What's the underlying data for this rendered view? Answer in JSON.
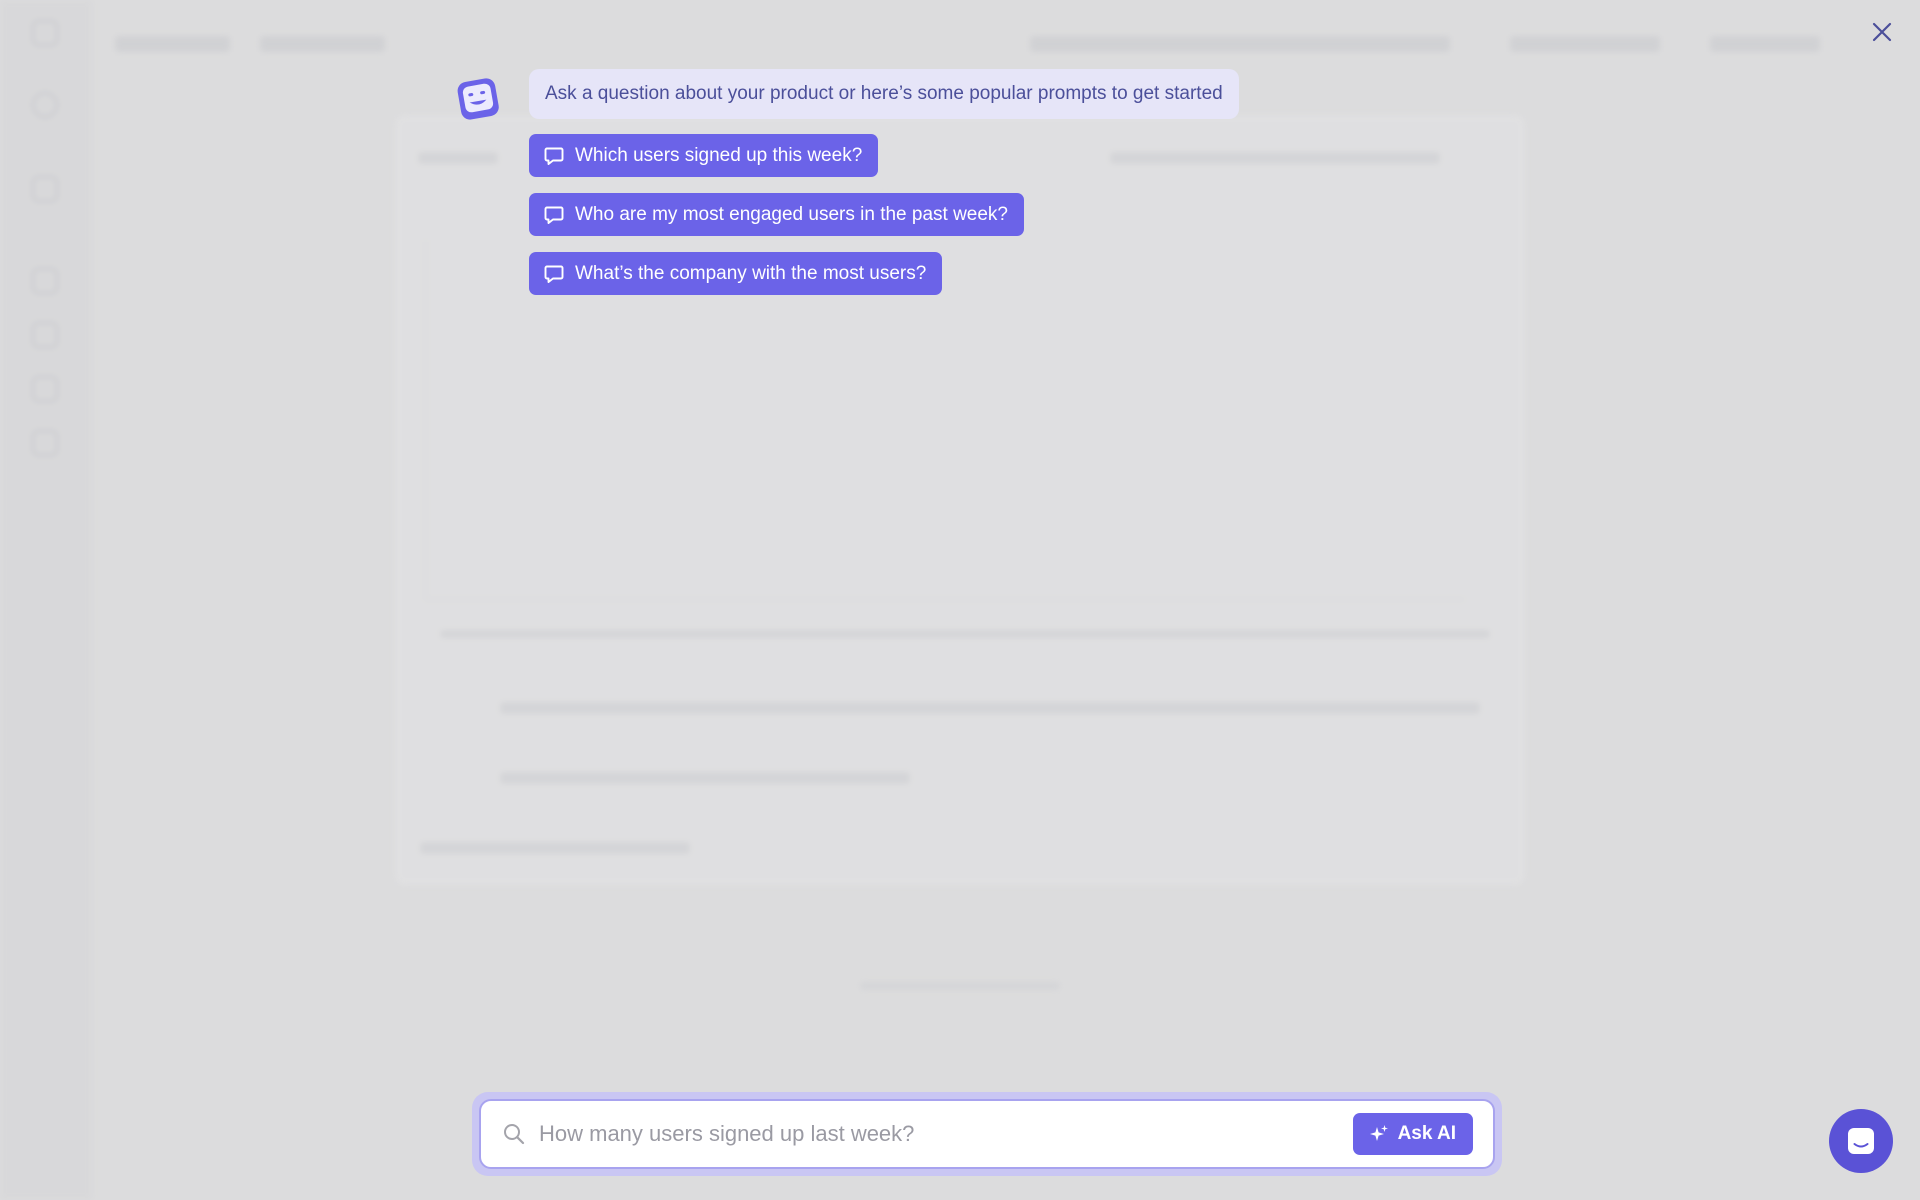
{
  "overlay": {
    "intro_text": "Ask a question about your product or here’s some popular prompts to get started",
    "prompts": [
      "Which users signed up this week?",
      "Who are my most engaged users in the past week?",
      "What’s the company with the most users?"
    ]
  },
  "search": {
    "placeholder": "How many users signed up last week?",
    "value": "",
    "button_label": "Ask AI"
  },
  "icons": {
    "close": "close-icon",
    "avatar": "assistant-avatar-icon",
    "prompt": "chat-bubble-icon",
    "search": "search-icon",
    "sparkle": "sparkle-icon",
    "launcher": "chat-launcher-icon"
  },
  "colors": {
    "accent": "#6b63e8",
    "intro_bubble": "#e6e5f8",
    "overlay_background": "#dcdcdd",
    "launcher": "#5a52d6"
  }
}
